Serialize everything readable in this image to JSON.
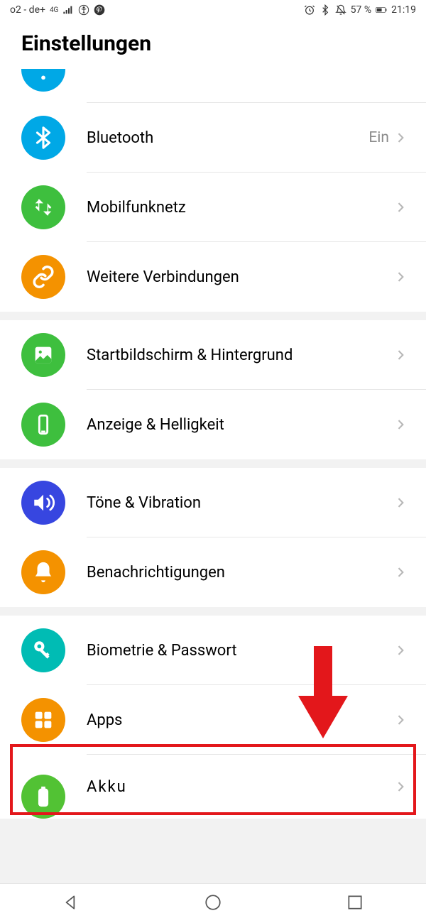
{
  "status": {
    "carrier": "o2 - de+",
    "network": "4G",
    "battery_text": "57 %",
    "time": "21:19"
  },
  "title": "Einstellungen",
  "rows": {
    "bluetooth": {
      "label": "Bluetooth",
      "value": "Ein"
    },
    "mobile": {
      "label": "Mobilfunknetz"
    },
    "moreconn": {
      "label": "Weitere Verbindungen"
    },
    "home": {
      "label": "Startbildschirm & Hintergrund"
    },
    "display": {
      "label": "Anzeige & Helligkeit"
    },
    "sound": {
      "label": "Töne & Vibration"
    },
    "notif": {
      "label": "Benachrichtigungen"
    },
    "biometric": {
      "label": "Biometrie & Passwort"
    },
    "apps": {
      "label": "Apps"
    },
    "battery": {
      "label": "Akku"
    }
  }
}
